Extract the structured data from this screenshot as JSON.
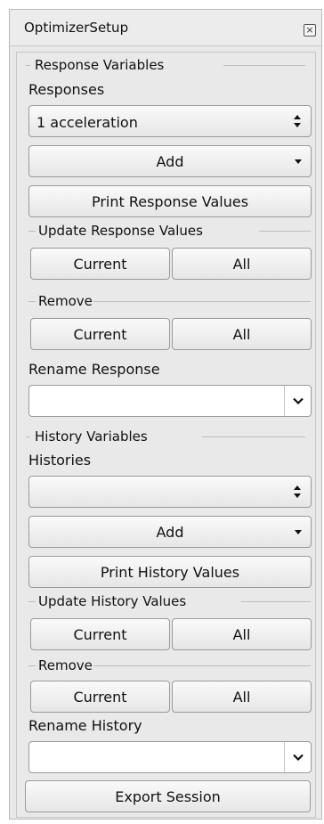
{
  "window": {
    "title": "OptimizerSetup"
  },
  "responses": {
    "group_title": "Response Variables",
    "label": "Responses",
    "selected": "1 acceleration",
    "add_label": "Add",
    "print_label": "Print Response Values",
    "update_group_title": "Update Response Values",
    "update_current_label": "Current",
    "update_all_label": "All",
    "remove_group_title": "Remove",
    "remove_current_label": "Current",
    "remove_all_label": "All",
    "rename_label": "Rename Response",
    "rename_value": ""
  },
  "histories": {
    "group_title": "History Variables",
    "label": "Histories",
    "selected": "",
    "add_label": "Add",
    "print_label": "Print History Values",
    "update_group_title": "Update History Values",
    "update_current_label": "Current",
    "update_all_label": "All",
    "remove_group_title": "Remove",
    "remove_current_label": "Current",
    "remove_all_label": "All",
    "rename_label": "Rename History",
    "rename_value": ""
  },
  "export_label": "Export Session",
  "icons": {
    "close": "close-icon",
    "spin": "up-down-spin-icon",
    "dropdown": "chevron-down-icon"
  }
}
